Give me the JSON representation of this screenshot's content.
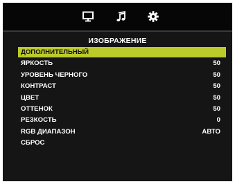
{
  "osd": {
    "icons": [
      {
        "name": "monitor-icon"
      },
      {
        "name": "music-note-icon"
      },
      {
        "name": "gear-icon"
      }
    ],
    "title": "ИЗОБРАЖЕНИЕ",
    "selected_index": 0,
    "highlight_color": "#bccb2a",
    "items": [
      {
        "label": "ДОПОЛНИТЕЛЬНЫЙ",
        "value": ""
      },
      {
        "label": "ЯРКОСТЬ",
        "value": "50"
      },
      {
        "label": "УРОВЕНЬ ЧЕРНОГО",
        "value": "50"
      },
      {
        "label": "КОНТРАСТ",
        "value": "50"
      },
      {
        "label": "ЦВЕТ",
        "value": "50"
      },
      {
        "label": "ОТТЕНОК",
        "value": "50"
      },
      {
        "label": "РЕЗКОСТЬ",
        "value": "0"
      },
      {
        "label": "RGB ДИАПАЗОН",
        "value": "АВТО"
      },
      {
        "label": "СБРОС",
        "value": ""
      }
    ]
  }
}
